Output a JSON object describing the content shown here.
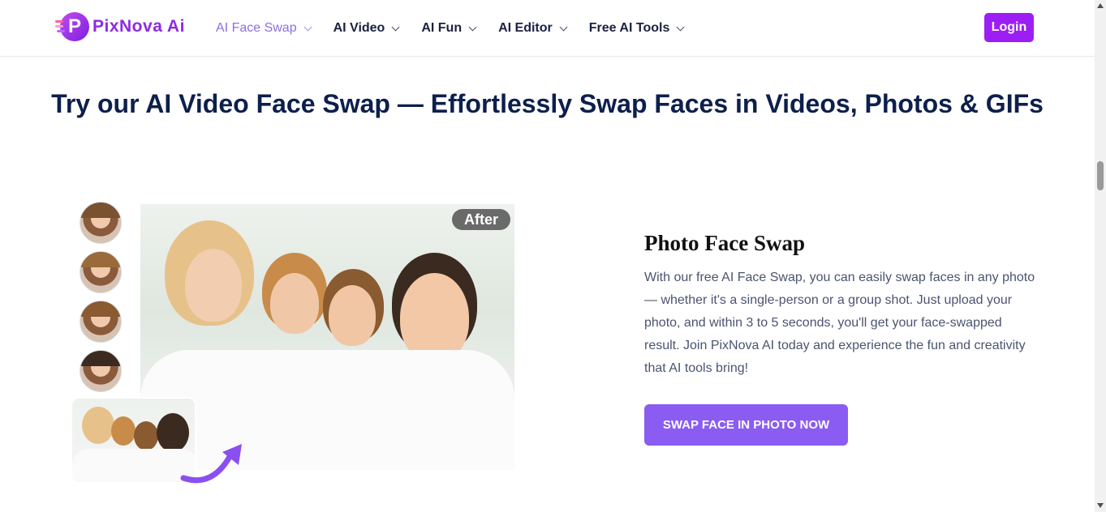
{
  "header": {
    "logo_text": "PixNova Ai",
    "nav": [
      {
        "label": "AI Face Swap",
        "active": true
      },
      {
        "label": "AI Video",
        "active": false
      },
      {
        "label": "AI Fun",
        "active": false
      },
      {
        "label": "AI Editor",
        "active": false
      },
      {
        "label": "Free AI Tools",
        "active": false
      }
    ],
    "login_label": "Login"
  },
  "hero": {
    "title": "Try our AI Video Face Swap — Effortlessly Swap Faces in Videos, Photos & GIFs"
  },
  "showcase": {
    "after_label": "After",
    "thumbnail_count": 4
  },
  "feature": {
    "title": "Photo Face Swap",
    "description": "With our free AI Face Swap, you can easily swap faces in any photo — whether it's a single-person or a group shot. Just upload your photo, and within 3 to 5 seconds, you'll get your face-swapped result. Join PixNova AI today and experience the fun and creativity that AI tools bring!",
    "cta_label": "SWAP FACE IN PHOTO NOW"
  },
  "colors": {
    "brand": "#9c1ef4",
    "accent": "#8a5cf2",
    "nav_active": "#8c6fe4",
    "heading": "#0d1f4c"
  }
}
